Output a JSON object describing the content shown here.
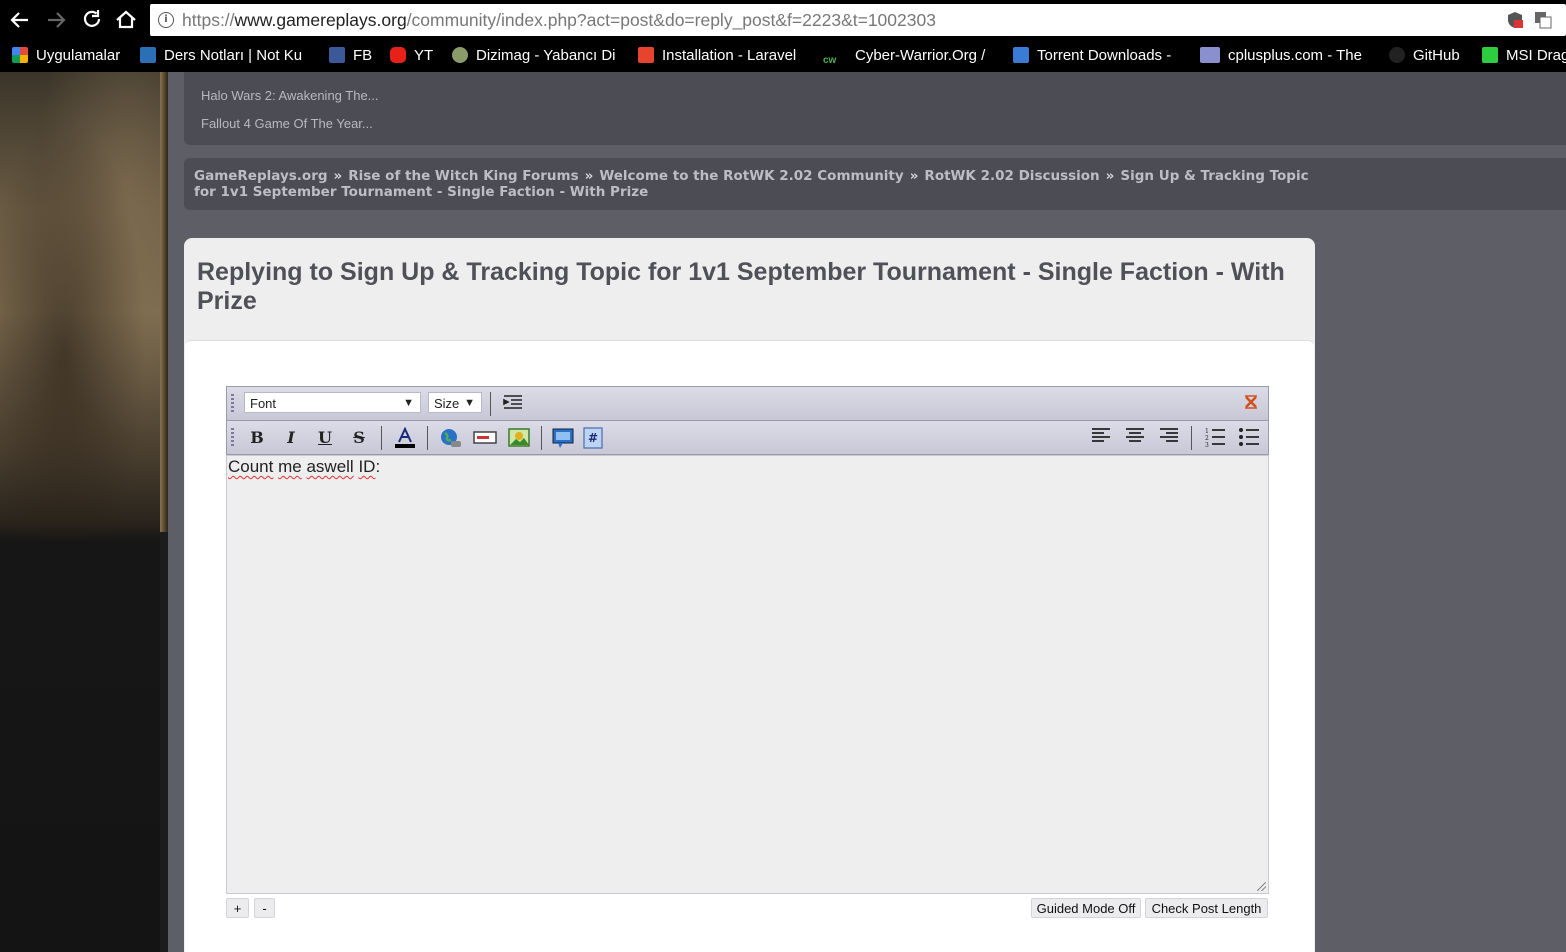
{
  "browser": {
    "url_scheme": "https://",
    "url_host": "www.gamereplays.org",
    "url_path": "/community/index.php?act=post&do=reply_post&f=2223&t=1002303",
    "bookmarks": [
      {
        "label": "Uygulamalar",
        "icon": "apps-grid-icon",
        "color": "#e04b3a"
      },
      {
        "label": "Ders Notları | Not Ku",
        "icon": "notkutusu-icon",
        "color": "#2b6fb6"
      },
      {
        "label": "FB",
        "icon": "facebook-icon",
        "color": "#3b5998"
      },
      {
        "label": "YT",
        "icon": "youtube-icon",
        "color": "#e62117"
      },
      {
        "label": "Dizimag - Yabancı Di",
        "icon": "dizimag-icon",
        "color": "#8a9a6a"
      },
      {
        "label": "Installation - Laravel",
        "icon": "laravel-icon",
        "color": "#e74430"
      },
      {
        "label": "Cyber-Warrior.Org / ",
        "icon": "cyberwarrior-icon",
        "color": "#4caf50"
      },
      {
        "label": "Torrent Downloads -",
        "icon": "torrent-icon",
        "color": "#3a7bd5"
      },
      {
        "label": "cplusplus.com - The ",
        "icon": "cplusplus-icon",
        "color": "#8a8fd0"
      },
      {
        "label": "GitHub",
        "icon": "github-icon",
        "color": "#222222"
      },
      {
        "label": "MSI Drag",
        "icon": "msi-dragon-icon",
        "color": "#2ecc40"
      }
    ]
  },
  "topics": [
    "Halo Wars 2: Awakening The...",
    "Fallout 4 Game Of The Year..."
  ],
  "breadcrumbs": [
    "GameReplays.org",
    "Rise of the Witch King Forums",
    "Welcome to the RotWK 2.02 Community",
    "RotWK 2.02 Discussion",
    "Sign Up & Tracking Topic for 1v1 September Tournament - Single Faction - With Prize"
  ],
  "reply": {
    "title": "Replying to Sign Up & Tracking Topic for 1v1 September Tournament - Single Faction - With Prize"
  },
  "editor": {
    "font_select": "Font",
    "size_select": "Size",
    "content_words": [
      "Count",
      "me",
      "aswell",
      "ID"
    ],
    "content_suffix": ":",
    "plus_label": "+",
    "minus_label": "-",
    "guided_mode_label": "Guided Mode Off",
    "check_length_label": "Check Post Length"
  },
  "colors": {
    "page_bg": "#5e5e66",
    "panel_bg": "#eeeeef",
    "title_color": "#505058",
    "crumb_color": "#bdbdc4"
  }
}
